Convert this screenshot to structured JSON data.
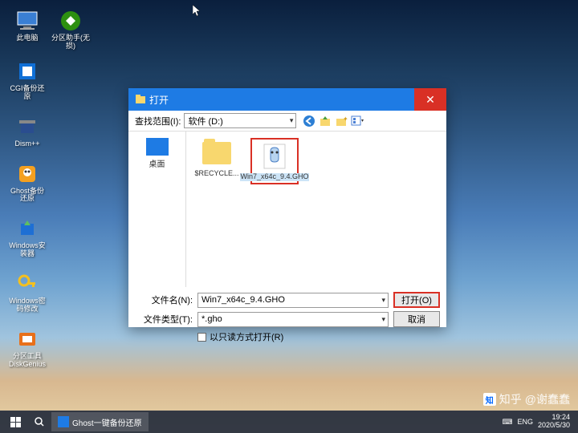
{
  "desktop": {
    "icons": [
      {
        "label": "此电脑"
      },
      {
        "label": "分区助手(无损)"
      },
      {
        "label": "CGI备份还原"
      },
      {
        "label": "Dism++"
      },
      {
        "label": "Ghost备份还原"
      },
      {
        "label": "Windows安装器"
      },
      {
        "label": "Windows密码修改"
      },
      {
        "label": "分区工具DiskGenius"
      }
    ]
  },
  "dialog": {
    "title": "打开",
    "location_label": "查找范围(I):",
    "location_value": "软件 (D:)",
    "sidebar": {
      "desktop": "桌面"
    },
    "files": [
      {
        "name": "$RECYCLE..."
      },
      {
        "name": "Win7_x64c_9.4.GHO"
      }
    ],
    "filename_label": "文件名(N):",
    "filename_value": "Win7_x64c_9.4.GHO",
    "filetype_label": "文件类型(T):",
    "filetype_value": "*.gho",
    "readonly_label": "以只读方式打开(R)",
    "open_btn": "打开(O)",
    "cancel_btn": "取消"
  },
  "taskbar": {
    "app": "Ghost一键备份还原",
    "lang": "ENG",
    "time": "19:24",
    "date": "2020/5/30"
  },
  "watermark": {
    "text": "@谢蠢蠢",
    "brand": "知乎"
  }
}
